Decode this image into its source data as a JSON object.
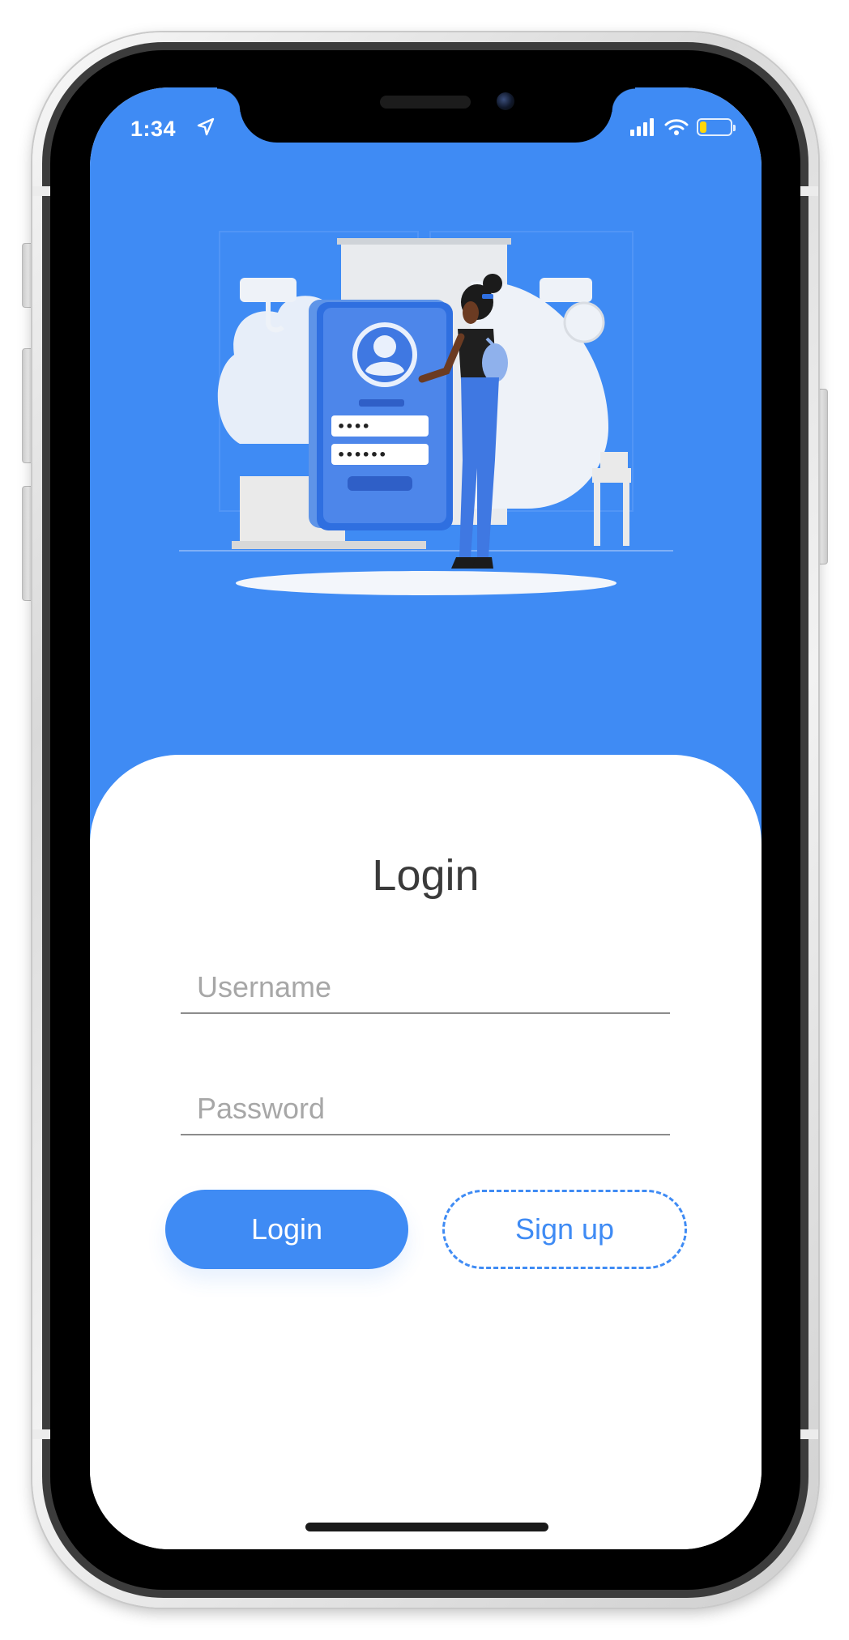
{
  "status_bar": {
    "time": "1:34",
    "location_icon": "location-arrow-icon",
    "signal_icon": "cellular-signal-icon",
    "wifi_icon": "wifi-icon",
    "battery_icon": "battery-low-icon",
    "battery_level": 0.22
  },
  "hero": {
    "illustration": "login-illustration-woman-with-phone",
    "password_dots_short": "••••",
    "password_dots_long": "••••••"
  },
  "login_form": {
    "title": "Login",
    "username_placeholder": "Username",
    "password_placeholder": "Password",
    "login_button_label": "Login",
    "signup_button_label": "Sign up"
  },
  "colors": {
    "primary": "#3f8bf4",
    "background": "#ffffff",
    "title_text": "#3a3a3a",
    "placeholder_text": "#a7a7a7",
    "battery_fill": "#ffd60a"
  }
}
